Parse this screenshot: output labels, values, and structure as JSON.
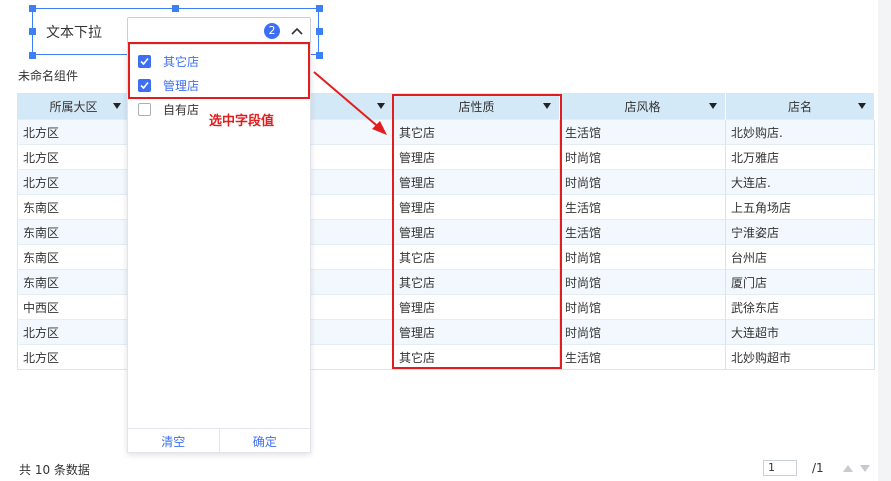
{
  "filter": {
    "label": "文本下拉",
    "selected_count": "2"
  },
  "component_title": "未命名组件",
  "dropdown": {
    "options": [
      {
        "label": "其它店",
        "checked": true
      },
      {
        "label": "管理店",
        "checked": true
      },
      {
        "label": "自有店",
        "checked": false
      }
    ],
    "clear_label": "清空",
    "confirm_label": "确定"
  },
  "annotation": {
    "text": "选中字段值",
    "color": "#e31d1d"
  },
  "table": {
    "columns": [
      "所属大区",
      "",
      "店性质",
      "店风格",
      "店名"
    ],
    "rows": [
      [
        "北方区",
        "",
        "其它店",
        "生活馆",
        "北妙购店."
      ],
      [
        "北方区",
        "",
        "管理店",
        "时尚馆",
        "北万雅店"
      ],
      [
        "北方区",
        "",
        "管理店",
        "时尚馆",
        "大连店."
      ],
      [
        "东南区",
        "",
        "管理店",
        "生活馆",
        "上五角场店"
      ],
      [
        "东南区",
        "",
        "管理店",
        "生活馆",
        "宁淮姿店"
      ],
      [
        "东南区",
        "",
        "其它店",
        "时尚馆",
        "台州店"
      ],
      [
        "东南区",
        "",
        "其它店",
        "时尚馆",
        "厦门店"
      ],
      [
        "中西区",
        "",
        "管理店",
        "时尚馆",
        "武徐东店"
      ],
      [
        "北方区",
        "",
        "管理店",
        "时尚馆",
        "大连超市"
      ],
      [
        "北方区",
        "",
        "其它店",
        "生活馆",
        "北妙购超市"
      ]
    ]
  },
  "footer": {
    "count_text": "共 10 条数据",
    "page_value": "1",
    "page_total": "/1"
  },
  "colors": {
    "accent": "#3d6ff5",
    "header_bg": "#d4e9f8",
    "alt_row_bg": "#f2f8fd"
  }
}
